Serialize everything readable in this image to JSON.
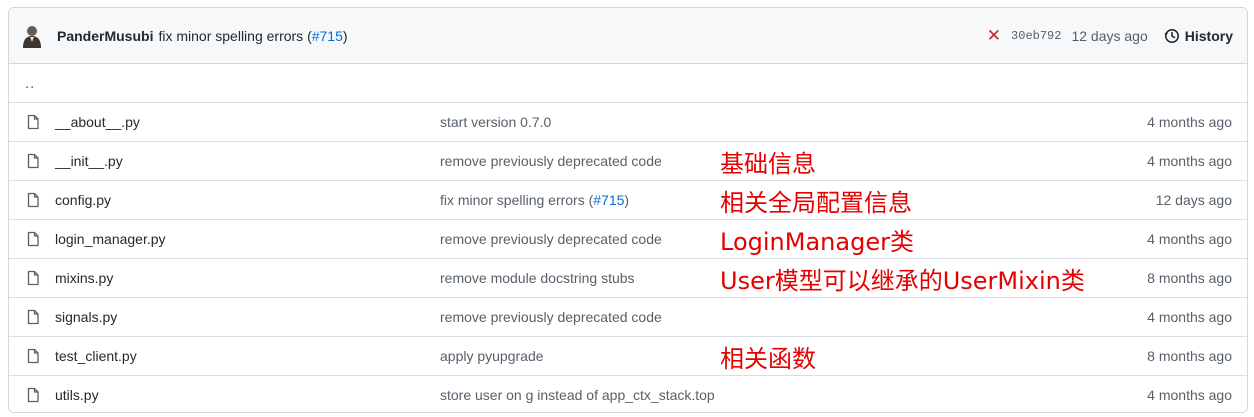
{
  "header": {
    "author": "PanderMusubi",
    "message": "fix minor spelling errors (",
    "pr": "#715",
    "message_end": ")",
    "status": "✕",
    "sha": "30eb792",
    "time": "12 days ago",
    "history_label": "History"
  },
  "parent": "..",
  "files": [
    {
      "name": "__about__.py",
      "commit": "start version 0.7.0",
      "note": "",
      "age": "4 months ago"
    },
    {
      "name": "__init__.py",
      "commit": "remove previously deprecated code",
      "note": "基础信息",
      "age": "4 months ago"
    },
    {
      "name": "config.py",
      "commit": "fix minor spelling errors (",
      "commit_pr": "#715",
      "commit_end": ")",
      "note": "相关全局配置信息",
      "age": "12 days ago"
    },
    {
      "name": "login_manager.py",
      "commit": "remove previously deprecated code",
      "note": "LoginManager类",
      "age": "4 months ago"
    },
    {
      "name": "mixins.py",
      "commit": "remove module docstring stubs",
      "note": "User模型可以继承的UserMixin类",
      "age": "8 months ago"
    },
    {
      "name": "signals.py",
      "commit": "remove previously deprecated code",
      "note": "",
      "age": "4 months ago"
    },
    {
      "name": "test_client.py",
      "commit": "apply pyupgrade",
      "note": "相关函数",
      "age": "8 months ago"
    },
    {
      "name": "utils.py",
      "commit": "store user on g instead of app_ctx_stack.top",
      "note": "",
      "age": "4 months ago"
    }
  ],
  "colors": {
    "link": "#0969da",
    "annotation": "#e60000",
    "fail": "#cf222e"
  }
}
